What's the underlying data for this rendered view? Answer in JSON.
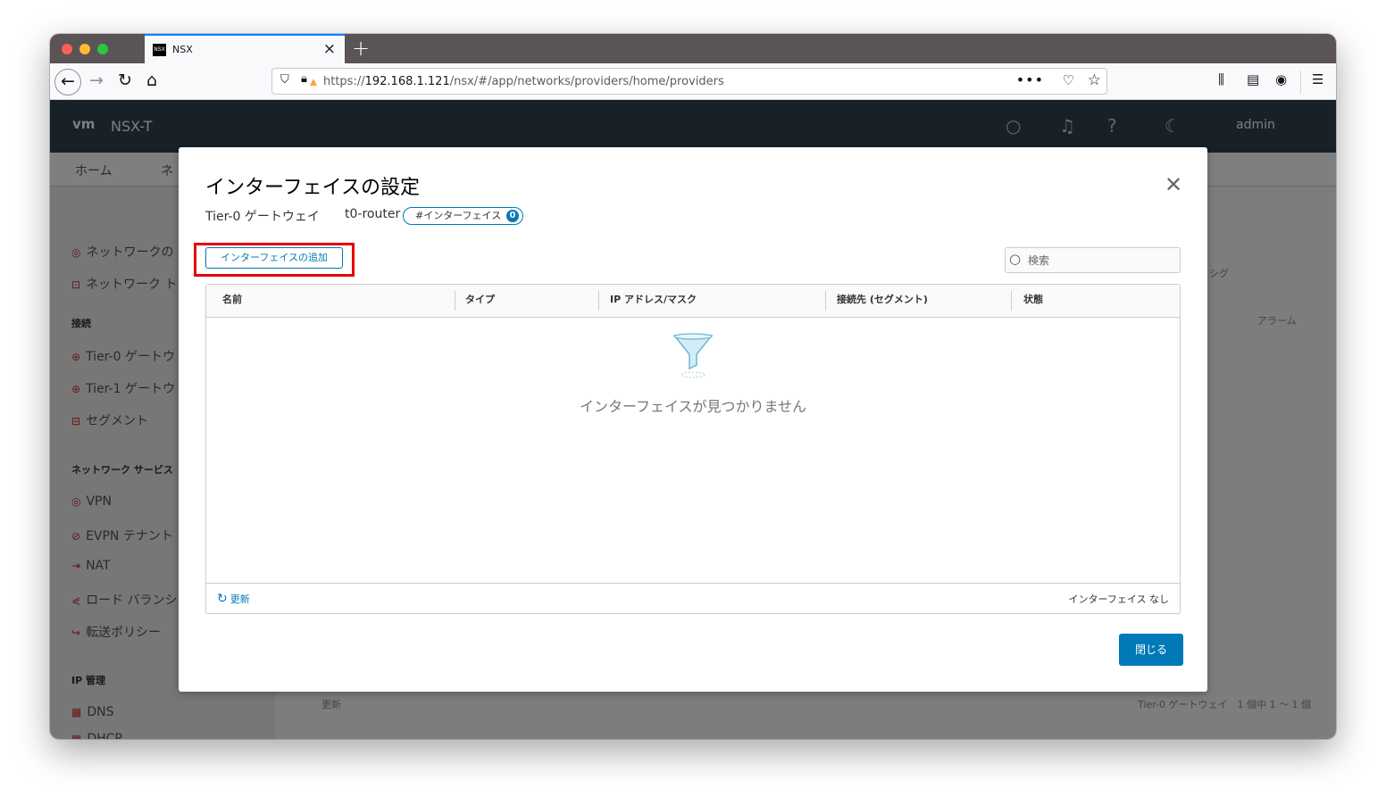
{
  "browser": {
    "tab_title": "NSX",
    "favicon_text": "NSX",
    "url_prefix": "https://",
    "url_host": "192.168.1.121",
    "url_path": "/nsx/#/app/networks/providers/home/providers"
  },
  "app": {
    "logo": "vm",
    "product": "NSX-T",
    "user": "admin",
    "subnav": [
      "ホーム",
      "ネ"
    ],
    "sidebar": {
      "items_top": [
        "ネットワークの",
        "ネットワーク ト"
      ],
      "section_connect": "接続",
      "items_connect": [
        "Tier-0 ゲートウ",
        "Tier-1 ゲートウ",
        "セグメント"
      ],
      "section_services": "ネットワーク サービス",
      "items_services": [
        "VPN",
        "EVPN テナント",
        "NAT",
        "ロード バランシ",
        "転送ポリシー"
      ],
      "section_ip": "IP 管理",
      "items_ip": [
        "DNS",
        "DHCP"
      ]
    },
    "bg_alarm_col": "アラーム",
    "bg_filter": "シグ",
    "bg_refresh": "更新",
    "bg_count": "Tier-0 ゲートウェイ　1 個中 1 ～ 1 個"
  },
  "dialog": {
    "title": "インターフェイスの設定",
    "gateway_label": "Tier-0 ゲートウェイ",
    "router_name": "t0-router",
    "pill_label": "#インターフェイス",
    "pill_count": "0",
    "add_button": "インターフェイスの追加",
    "search_placeholder": "検索",
    "columns": [
      "名前",
      "タイプ",
      "IP アドレス/マスク",
      "接続先 (セグメント)",
      "状態"
    ],
    "empty_message": "インターフェイスが見つかりません",
    "refresh_label": "更新",
    "footer_count": "インターフェイス なし",
    "close_button": "閉じる"
  },
  "colors": {
    "accent": "#0079b8",
    "highlight": "#e6000a",
    "header_bg": "#314351"
  }
}
